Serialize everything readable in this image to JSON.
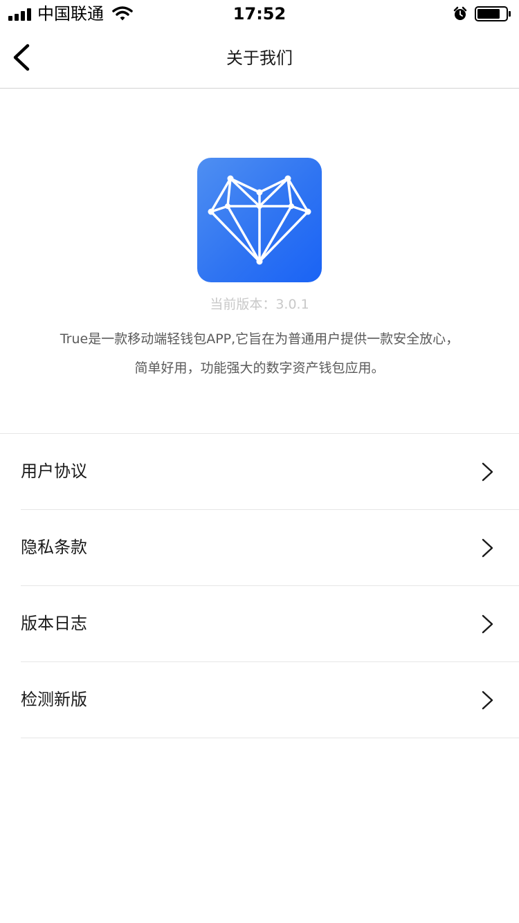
{
  "status_bar": {
    "carrier": "中国联通",
    "time": "17:52",
    "icons": [
      "signal-icon",
      "wifi-icon",
      "alarm-icon",
      "battery-icon"
    ],
    "battery_level": 0.8
  },
  "nav": {
    "title": "关于我们",
    "back_icon": "back-arrow-icon"
  },
  "about": {
    "app_icon": "diamond-heart-logo",
    "version_text": "当前版本：3.0.1",
    "description_line1": "True是一款移动端轻钱包APP,它旨在为普通用户提供一款安全放心，",
    "description_line2": "简单好用，功能强大的数字资产钱包应用。"
  },
  "menu": {
    "items": [
      {
        "label": "用户协议",
        "icon": "chevron-right-icon"
      },
      {
        "label": "隐私条款",
        "icon": "chevron-right-icon"
      },
      {
        "label": "版本日志",
        "icon": "chevron-right-icon"
      },
      {
        "label": "检测新版",
        "icon": "chevron-right-icon"
      }
    ]
  },
  "colors": {
    "brand_gradient_start": "#4f8ff2",
    "brand_gradient_end": "#1a63f5",
    "version_text": "#c8c8c8",
    "description_text": "#5a5a5a",
    "divider": "#e6e6e6"
  }
}
